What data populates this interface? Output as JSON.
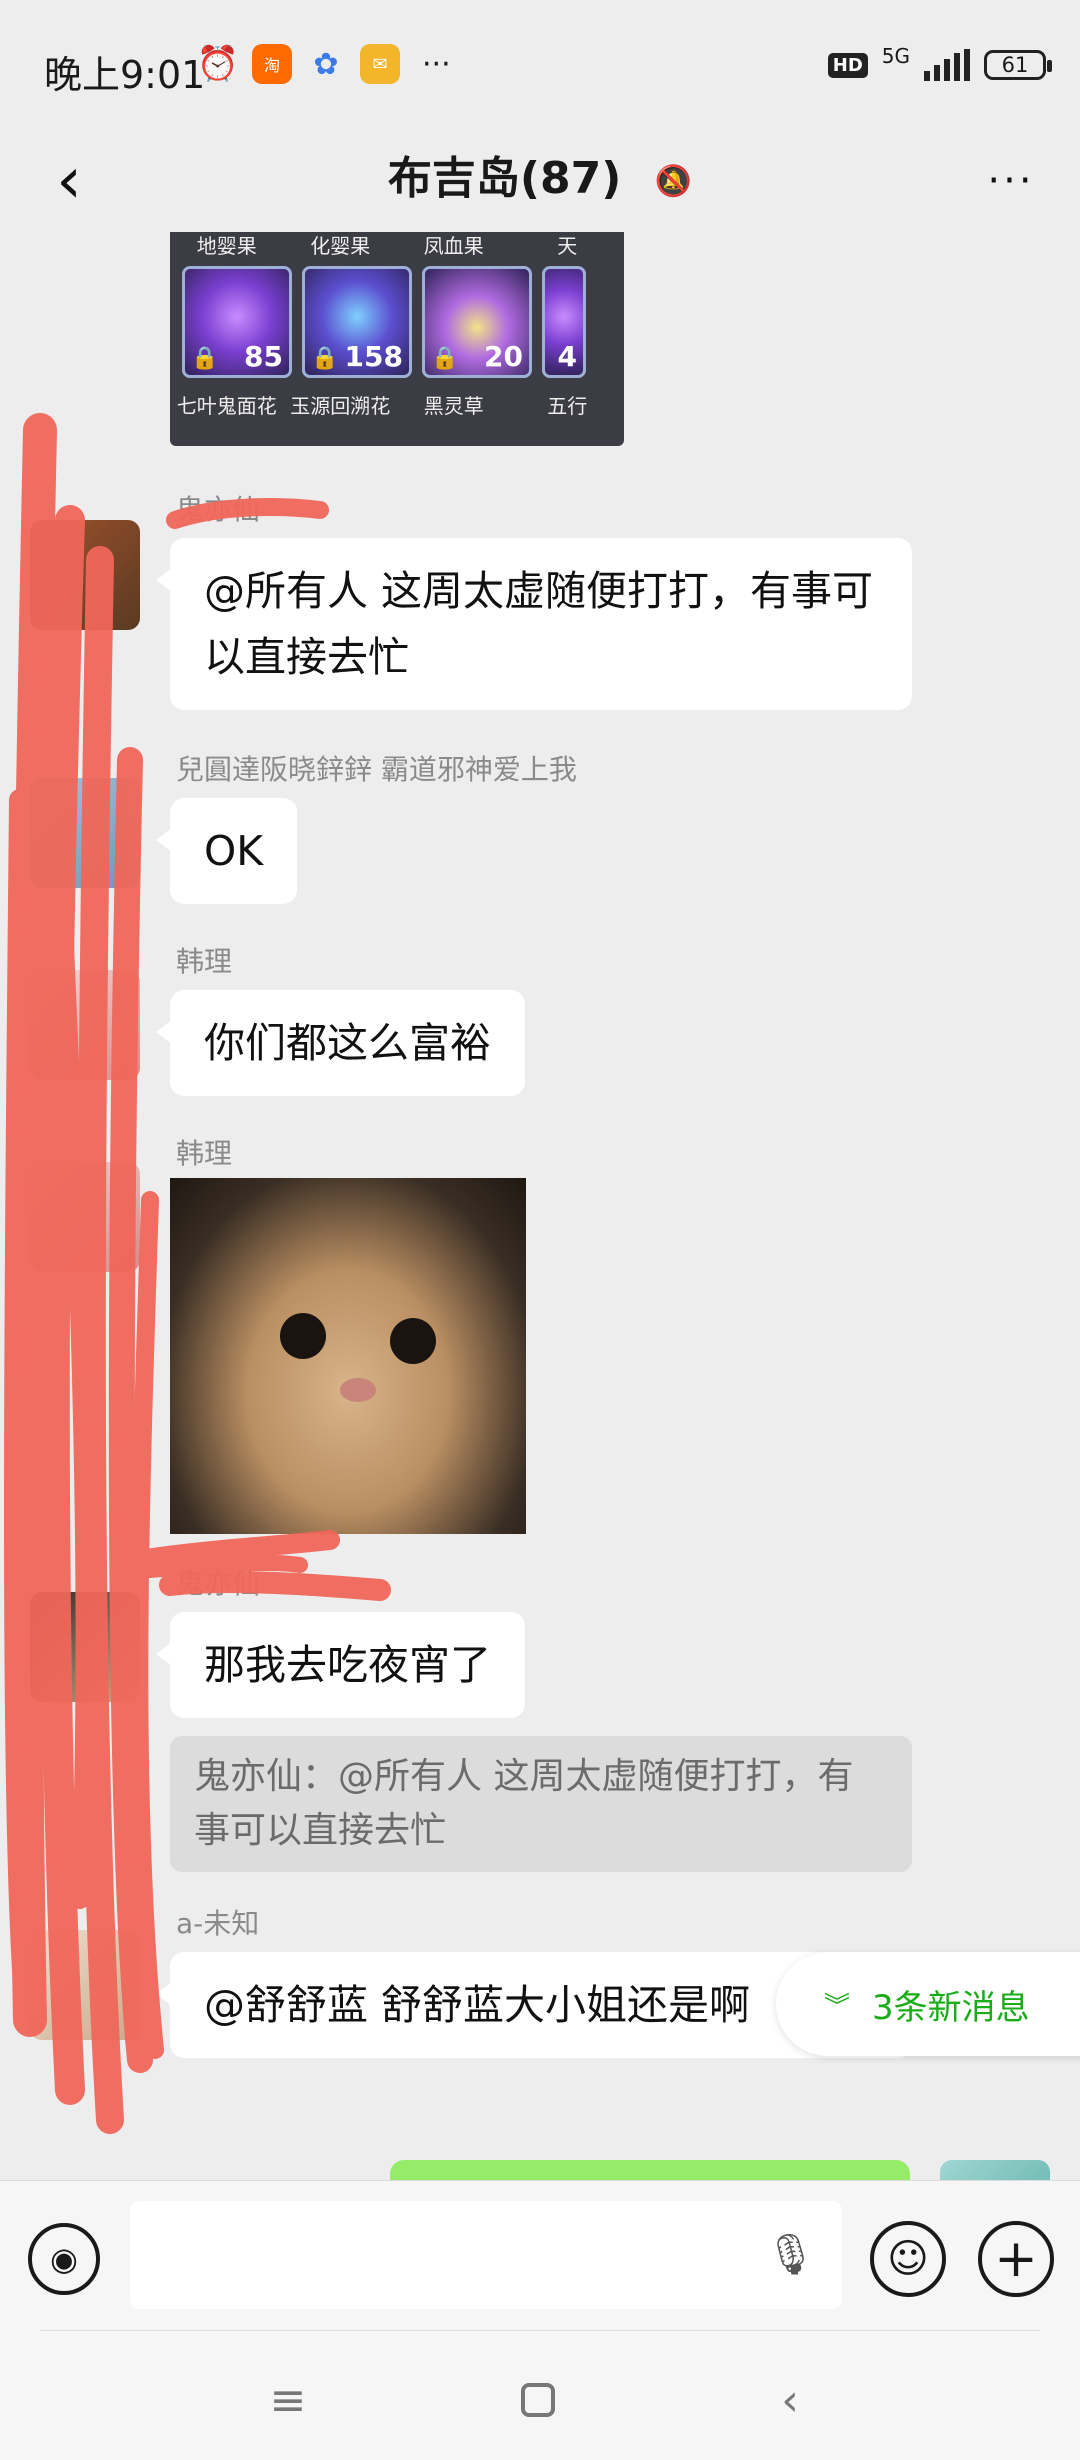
{
  "status_bar": {
    "time": "晚上9:01",
    "app_icons": [
      "alarm-icon",
      "taobao-icon",
      "baidu-icon",
      "app-icon"
    ],
    "more": "···",
    "hd": "HD",
    "network": "5G",
    "battery": "61"
  },
  "header": {
    "title": "布吉岛(87)",
    "back": "‹",
    "more": "···"
  },
  "messages": [
    {
      "type": "image",
      "image_labels": [
        "地婴果",
        "化婴果",
        "凤血果",
        "天"
      ],
      "counts": [
        "85",
        "158",
        "20",
        "4"
      ],
      "names": [
        "七叶鬼面花",
        "玉源回溯花",
        "黑灵草",
        "五行"
      ]
    },
    {
      "type": "text",
      "sender": "鬼亦仙",
      "text": "@所有人  这周太虚随便打打，有事可以直接去忙"
    },
    {
      "type": "text",
      "sender": "兒圓達阪晓鋅鋅 霸道邪神爱上我",
      "text": "OK"
    },
    {
      "type": "text",
      "sender": "韩理",
      "text": "你们都这么富裕"
    },
    {
      "type": "image",
      "sender": "韩理"
    },
    {
      "type": "text",
      "sender": "鬼亦仙",
      "text": "那我去吃夜宵了",
      "quote": "鬼亦仙：@所有人 这周太虚随便打打，有事可以直接去忙"
    },
    {
      "type": "text",
      "sender": "a-未知",
      "text": "@舒舒蓝  舒舒蓝大小姐还是啊"
    }
  ],
  "new_messages": "3条新消息",
  "colors": {
    "background": "#ededed",
    "bubble": "#ffffff",
    "accent": "#1aad19",
    "scribble": "#f0675a"
  }
}
